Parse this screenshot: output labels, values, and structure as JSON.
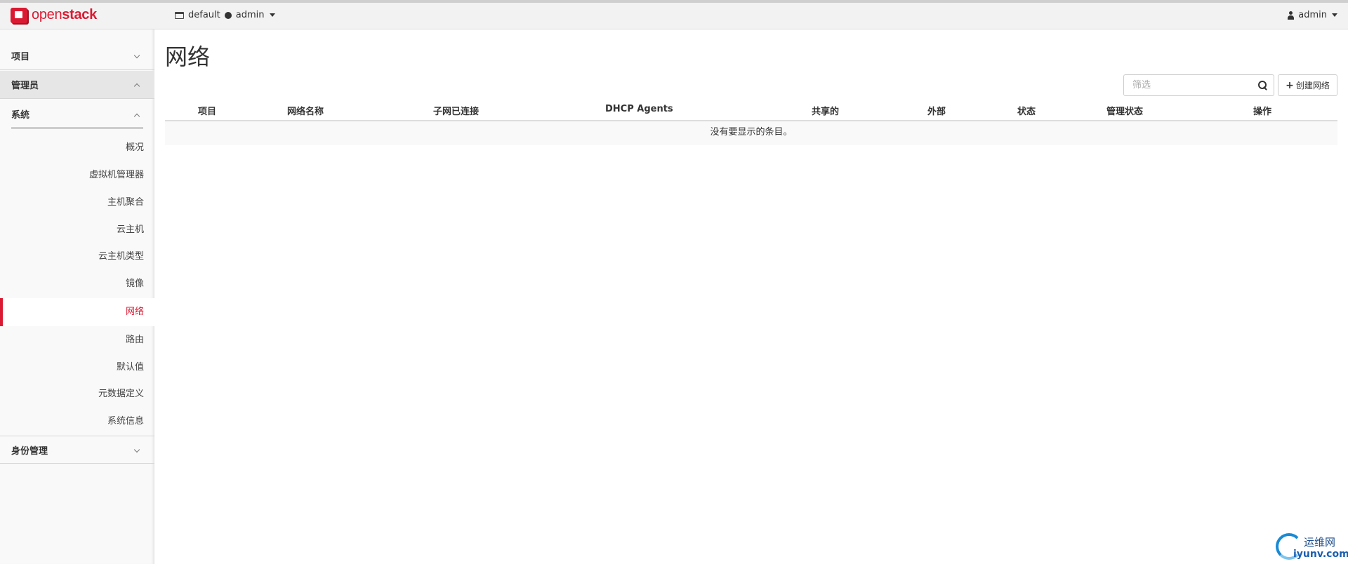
{
  "brand": {
    "open": "open",
    "stack": "stack"
  },
  "context": {
    "domain": "default",
    "project": "admin"
  },
  "user": {
    "name": "admin"
  },
  "sidebar": {
    "sections": [
      {
        "label": "项目",
        "expanded": false
      },
      {
        "label": "管理员",
        "expanded": true
      },
      {
        "label": "身份管理",
        "expanded": false
      }
    ],
    "subsection": {
      "label": "系统",
      "expanded": true
    },
    "items": [
      {
        "label": "概况"
      },
      {
        "label": "虚拟机管理器"
      },
      {
        "label": "主机聚合"
      },
      {
        "label": "云主机"
      },
      {
        "label": "云主机类型"
      },
      {
        "label": "镜像"
      },
      {
        "label": "网络",
        "active": true
      },
      {
        "label": "路由"
      },
      {
        "label": "默认值"
      },
      {
        "label": "元数据定义"
      },
      {
        "label": "系统信息"
      }
    ]
  },
  "main": {
    "title": "网络",
    "filter_placeholder": "筛选",
    "create_button": "创建网络",
    "columns": [
      "项目",
      "网络名称",
      "子网已连接",
      "DHCP Agents",
      "共享的",
      "外部",
      "状态",
      "管理状态",
      "操作"
    ],
    "empty_message": "没有要显示的条目。"
  },
  "watermark": {
    "cn": "运维网",
    "en": "iyunv.com"
  },
  "colors": {
    "accent": "#da1a32",
    "topbar": "#f2f2f2",
    "sidebar": "#f9f9f9"
  }
}
